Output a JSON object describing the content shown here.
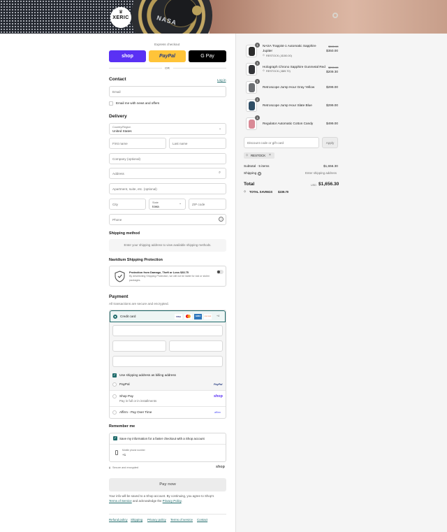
{
  "brand": {
    "logo_text": "XERIC"
  },
  "hero": {
    "dial_text": "NASA"
  },
  "express": {
    "label": "Express checkout",
    "shop_pay": "shop",
    "paypal": "PayPal",
    "gpay": "G Pay",
    "or": "OR"
  },
  "contact": {
    "title": "Contact",
    "login": "Log in",
    "email_placeholder": "Email",
    "news_label": "Email me with news and offers"
  },
  "delivery": {
    "title": "Delivery",
    "country_label": "Country/Region",
    "country_value": "United States",
    "first_name": "First name",
    "last_name": "Last name",
    "company": "Company (optional)",
    "address": "Address",
    "apartment": "Apartment, suite, etc. (optional)",
    "city": "City",
    "state_label": "State",
    "state_value": "Iowa",
    "zip": "ZIP code",
    "phone": "Phone"
  },
  "shipping_method": {
    "title": "Shipping method",
    "message": "Enter your shipping address to view available shipping methods."
  },
  "protection": {
    "title": "Navidium Shipping Protection",
    "line1": "Protection from Damage, Theft or Loss $33.75",
    "line2": "By deselecting Shipping Protection, we will not be liable for lost or stolen",
    "line3": "packages."
  },
  "payment": {
    "title": "Payment",
    "subtitle": "All transactions are secure and encrypted.",
    "credit_card": "Credit card",
    "card_logos": [
      "VISA",
      "MC",
      "AMEX",
      "DISCOVER",
      "+4"
    ],
    "billing_label": "Use shipping address as billing address",
    "paypal": "PayPal",
    "paypal_logo": "PayPal",
    "shop_pay": "Shop Pay",
    "shop_pay_sub": "Pay in full or in installments",
    "shop_logo": "shop",
    "affirm": "Affirm - Pay Over Time",
    "affirm_logo": "affirm"
  },
  "remember": {
    "title": "Remember me",
    "save_label": "Save my information for a faster checkout with a Shop account",
    "mobile_label": "Mobile phone number",
    "mobile_value": "+1",
    "secure": "Secure and encrypted",
    "shop_logo": "shop"
  },
  "pay_button": "Pay now",
  "disclaimer": {
    "line1": "Your info will be saved to a Shop account. By continuing, you agree to Shop's",
    "terms": "Terms of Service",
    "and": "and acknowledge the",
    "privacy": "Privacy Policy",
    "end": "."
  },
  "footer_links": [
    "Refund policy",
    "Shipping",
    "Privacy policy",
    "Terms of service",
    "Contact"
  ],
  "cart": {
    "items": [
      {
        "name_line1": "NASA Trappist-1 Automatic Sapphire",
        "name_line2": "Jupiter",
        "discount": "RESTOCK (-$150.00)",
        "qty": "1",
        "old_price": "$500.00",
        "price": "$350.00",
        "color": "#2b2b2b"
      },
      {
        "name_line1": "Holograph Chrono Sapphire Gunmetal Red",
        "name_line2": "",
        "discount": "RESTOCK (-$89.70)",
        "qty": "1",
        "old_price": "$299.00",
        "price": "$209.30",
        "color": "#333438"
      },
      {
        "name_line1": "Retroscope Jump Hour Gray Yellow",
        "name_line2": "",
        "discount": "",
        "qty": "1",
        "old_price": "",
        "price": "$299.00",
        "color": "#6b6e72"
      },
      {
        "name_line1": "Retroscope Jump Hour Slate Blue",
        "name_line2": "",
        "discount": "",
        "qty": "1",
        "old_price": "",
        "price": "$299.00",
        "color": "#2f4e66"
      },
      {
        "name_line1": "Regulator Automatic Cotton Candy",
        "name_line2": "",
        "discount": "",
        "qty": "1",
        "old_price": "",
        "price": "$499.00",
        "color": "#d98a96"
      }
    ],
    "discount_placeholder": "Discount code or gift card",
    "apply": "Apply",
    "code_tag": "RESTOCK",
    "subtotal_label": "Subtotal · 5 items",
    "subtotal_value": "$1,656.30",
    "shipping_label": "Shipping",
    "shipping_value": "Enter shipping address",
    "total_label": "Total",
    "currency": "USD",
    "total_value": "$1,656.30",
    "savings_label": "TOTAL SAVINGS",
    "savings_value": "$239.70"
  }
}
